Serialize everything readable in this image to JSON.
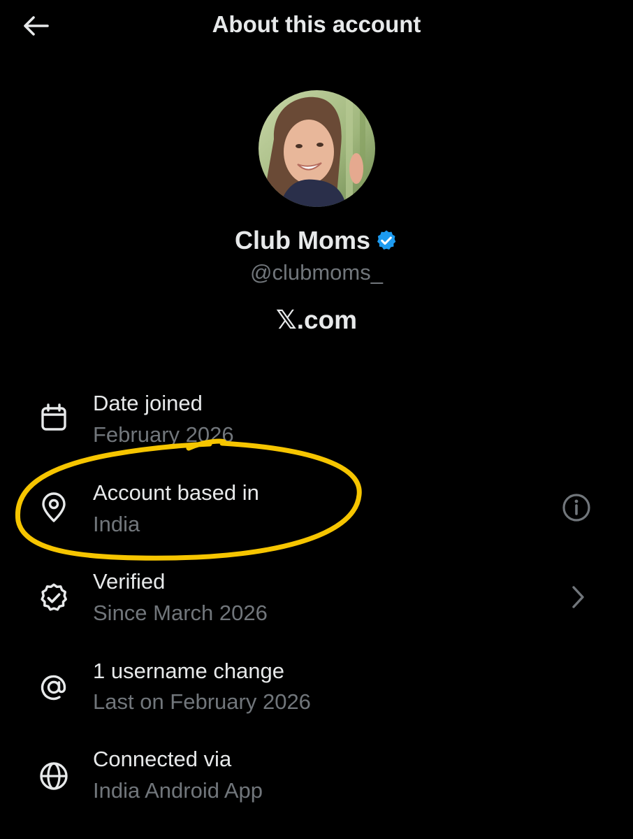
{
  "header": {
    "title": "About this account",
    "back_icon": "arrow-left-icon"
  },
  "profile": {
    "display_name": "Club Moms",
    "verified_badge_icon": "verified-badge-icon",
    "handle": "@clubmoms_",
    "site_prefix": "𝕏",
    "site_suffix": ".com"
  },
  "details": [
    {
      "icon": "calendar-icon",
      "label": "Date joined",
      "value": "February 2026"
    },
    {
      "icon": "location-pin-icon",
      "label": "Account based in",
      "value": "India",
      "trailing_icon": "info-icon"
    },
    {
      "icon": "verified-outline-icon",
      "label": "Verified",
      "value": "Since March 2026",
      "trailing_icon": "chevron-right-icon"
    },
    {
      "icon": "at-sign-icon",
      "label": "1 username change",
      "value": "Last on February 2026"
    },
    {
      "icon": "globe-icon",
      "label": "Connected via",
      "value": "India Android App"
    }
  ],
  "colors": {
    "background": "#000000",
    "primary_text": "#e7e9ea",
    "secondary_text": "#71767b",
    "verified_blue": "#1d9bf0",
    "highlight_yellow": "#f6c500"
  }
}
